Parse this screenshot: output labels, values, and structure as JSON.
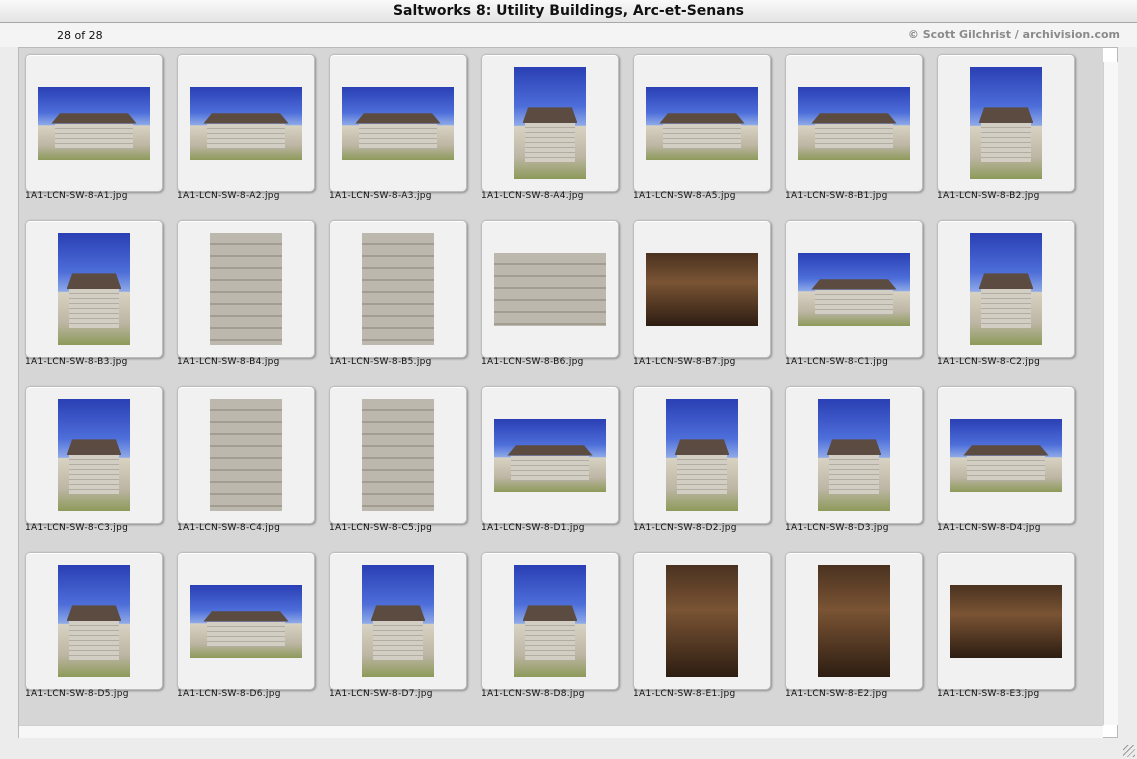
{
  "window": {
    "title": "Saltworks 8: Utility Buildings, Arc-et-Senans"
  },
  "header": {
    "count": "28 of 28",
    "credit": "© Scott Gilchrist / archivision.com"
  },
  "slides": [
    {
      "filename": "1A1-LCN-SW-8-A1.jpg",
      "orientation": "landscape"
    },
    {
      "filename": "1A1-LCN-SW-8-A2.jpg",
      "orientation": "landscape"
    },
    {
      "filename": "1A1-LCN-SW-8-A3.jpg",
      "orientation": "landscape"
    },
    {
      "filename": "1A1-LCN-SW-8-A4.jpg",
      "orientation": "portrait"
    },
    {
      "filename": "1A1-LCN-SW-8-A5.jpg",
      "orientation": "landscape"
    },
    {
      "filename": "1A1-LCN-SW-8-B1.jpg",
      "orientation": "landscape"
    },
    {
      "filename": "1A1-LCN-SW-8-B2.jpg",
      "orientation": "portrait"
    },
    {
      "filename": "1A1-LCN-SW-8-B3.jpg",
      "orientation": "portrait"
    },
    {
      "filename": "1A1-LCN-SW-8-B4.jpg",
      "orientation": "portrait",
      "style": "stone"
    },
    {
      "filename": "1A1-LCN-SW-8-B5.jpg",
      "orientation": "portrait",
      "style": "stone"
    },
    {
      "filename": "1A1-LCN-SW-8-B6.jpg",
      "orientation": "landscape",
      "style": "stone"
    },
    {
      "filename": "1A1-LCN-SW-8-B7.jpg",
      "orientation": "landscape",
      "style": "interior"
    },
    {
      "filename": "1A1-LCN-SW-8-C1.jpg",
      "orientation": "landscape"
    },
    {
      "filename": "1A1-LCN-SW-8-C2.jpg",
      "orientation": "portrait"
    },
    {
      "filename": "1A1-LCN-SW-8-C3.jpg",
      "orientation": "portrait"
    },
    {
      "filename": "1A1-LCN-SW-8-C4.jpg",
      "orientation": "portrait",
      "style": "stone"
    },
    {
      "filename": "1A1-LCN-SW-8-C5.jpg",
      "orientation": "portrait",
      "style": "stone"
    },
    {
      "filename": "1A1-LCN-SW-8-D1.jpg",
      "orientation": "landscape"
    },
    {
      "filename": "1A1-LCN-SW-8-D2.jpg",
      "orientation": "portrait"
    },
    {
      "filename": "1A1-LCN-SW-8-D3.jpg",
      "orientation": "portrait"
    },
    {
      "filename": "1A1-LCN-SW-8-D4.jpg",
      "orientation": "landscape"
    },
    {
      "filename": "1A1-LCN-SW-8-D5.jpg",
      "orientation": "portrait"
    },
    {
      "filename": "1A1-LCN-SW-8-D6.jpg",
      "orientation": "landscape"
    },
    {
      "filename": "1A1-LCN-SW-8-D7.jpg",
      "orientation": "portrait"
    },
    {
      "filename": "1A1-LCN-SW-8-D8.jpg",
      "orientation": "portrait"
    },
    {
      "filename": "1A1-LCN-SW-8-E1.jpg",
      "orientation": "portrait",
      "style": "interior"
    },
    {
      "filename": "1A1-LCN-SW-8-E2.jpg",
      "orientation": "portrait",
      "style": "interior"
    },
    {
      "filename": "1A1-LCN-SW-8-E3.jpg",
      "orientation": "landscape",
      "style": "interior"
    }
  ]
}
